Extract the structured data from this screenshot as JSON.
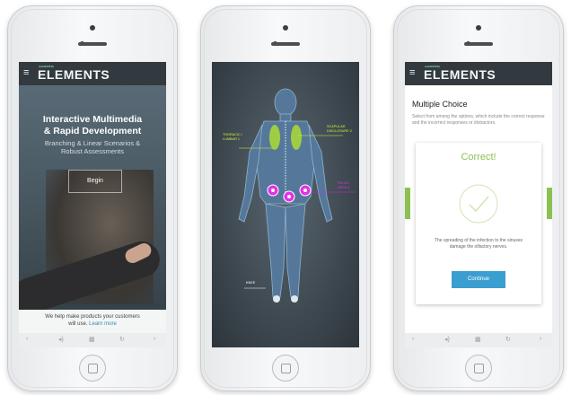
{
  "colors": {
    "brand_header": "#323a3f",
    "accent_green": "#8cc152",
    "accent_blue": "#3a9fd0",
    "highlight_magenta": "#d91ed6",
    "label_yellow": "#d8f13a"
  },
  "icons": [
    "hamburger-icon",
    "back-icon",
    "volume-icon",
    "grid-icon",
    "refresh-icon",
    "forward-icon",
    "checkmark-icon"
  ],
  "app": {
    "brand_name": "ELEMENTS",
    "brand_prefix": "eLEARNING"
  },
  "phone1": {
    "hero_title_line1": "Interactive Multimedia",
    "hero_title_line2": "& Rapid Development",
    "hero_sub_line1": "Branching & Linear Scenarios &",
    "hero_sub_line2": "Robust Assessments",
    "begin_label": "Begin",
    "footer_line1": "We help make products your customers",
    "footer_line2": "will use.",
    "footer_link": "Learn more"
  },
  "phone2": {
    "labels": {
      "thoracic": "THORACIC /",
      "lumbar": "LUMBAR 1",
      "scapular": "SCAPULAR",
      "scapular2": "DISCLOSURE 2",
      "pelvic1": "PELVIC",
      "pelvic2": "AREA 3",
      "heel": "KNEE"
    }
  },
  "phone3": {
    "question_title": "Multiple Choice",
    "instructions": "Select from among the options, which include the correct response and the incorrect responses or distractors.",
    "result_title": "Correct!",
    "feedback": "The spreading of the infection to the sinuses damage the olfactory nerves.",
    "continue_label": "Continue"
  },
  "navbar_glyphs": {
    "back": "‹",
    "volume": "◂)",
    "grid": "▦",
    "refresh": "↻",
    "forward": "›"
  }
}
